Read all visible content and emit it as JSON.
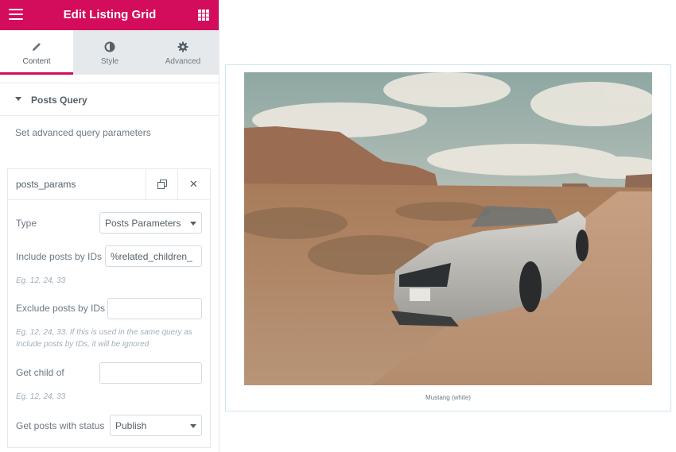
{
  "topbar": {
    "title": "Edit Listing Grid",
    "menu_icon": "hamburger-icon",
    "apps_icon": "grid-icon"
  },
  "tabs": [
    {
      "label": "Content",
      "icon": "pencil-icon",
      "active": true
    },
    {
      "label": "Style",
      "icon": "half-circle-icon",
      "active": false
    },
    {
      "label": "Advanced",
      "icon": "gear-icon",
      "active": false
    }
  ],
  "section": {
    "title": "Posts Query",
    "description": "Set advanced query parameters"
  },
  "repeater": {
    "item_title": "posts_params",
    "fields": {
      "type": {
        "label": "Type",
        "value": "Posts Parameters"
      },
      "include": {
        "label": "Include posts by IDs",
        "value": "%related_children_",
        "hint": "Eg. 12, 24, 33"
      },
      "exclude": {
        "label": "Exclude posts by IDs",
        "value": "",
        "hint": "Eg. 12, 24, 33. If this is used in the same query as Include posts by IDs, it will be ignored"
      },
      "child": {
        "label": "Get child of",
        "value": "",
        "hint": "Eg. 12, 24, 33"
      },
      "status": {
        "label": "Get posts with status",
        "value": "Publish"
      }
    }
  },
  "preview": {
    "caption": "Mustang (white)"
  },
  "colors": {
    "accent": "#d30c5c",
    "panel_gray": "#e6e9ec",
    "text": "#6d7882"
  }
}
